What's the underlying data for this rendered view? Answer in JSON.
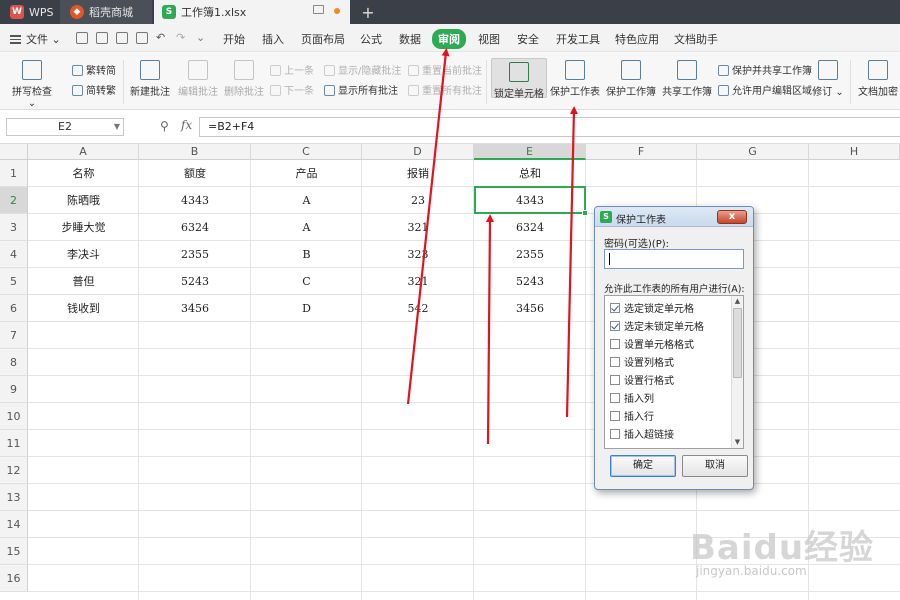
{
  "tabs": {
    "wps": "WPS",
    "shop": "稻壳商城",
    "doc": "工作簿1.xlsx"
  },
  "menu": {
    "file": "文件",
    "items": [
      "开始",
      "插入",
      "页面布局",
      "公式",
      "数据",
      "审阅",
      "视图",
      "安全",
      "开发工具",
      "特色应用",
      "文档助手"
    ],
    "active": "审阅"
  },
  "ribbon": {
    "spellcheck": "拼写检查",
    "to_traditional": "繁转简",
    "to_simplified": "简转繁",
    "new_comment": "新建批注",
    "edit_comment": "编辑批注",
    "delete_comment": "删除批注",
    "prev": "上一条",
    "next": "下一条",
    "show_hide_comment": "显示/隐藏批注",
    "show_all_comments": "显示所有批注",
    "reset_current_comment": "重置当前批注",
    "reset_all_comments": "重置所有批注",
    "lock_cells": "锁定单元格",
    "protect_sheet": "保护工作表",
    "protect_workbook": "保护工作簿",
    "share_workbook": "共享工作簿",
    "protect_share_workbook": "保护并共享工作簿",
    "allow_edit_ranges": "允许用户编辑区域",
    "track_changes": "修订",
    "doc_encrypt": "文档加密"
  },
  "formula_bar": {
    "name_box": "E2",
    "fx": "fx",
    "formula": "=B2+F4"
  },
  "sheet": {
    "columns": [
      "A",
      "B",
      "C",
      "D",
      "E",
      "F",
      "G",
      "H"
    ],
    "rows": [
      "1",
      "2",
      "3",
      "4",
      "5",
      "6",
      "7",
      "8",
      "9",
      "10",
      "11",
      "12",
      "13",
      "14",
      "15",
      "16"
    ],
    "headers": [
      "名称",
      "额度",
      "产品",
      "报销",
      "总和"
    ],
    "data": [
      [
        "陈晒哦",
        "4343",
        "A",
        "23",
        "4343"
      ],
      [
        "步睡大觉",
        "6324",
        "A",
        "321",
        "6324"
      ],
      [
        "李决斗",
        "2355",
        "B",
        "323",
        "2355"
      ],
      [
        "普但",
        "5243",
        "C",
        "321",
        "5243"
      ],
      [
        "钱收到",
        "3456",
        "D",
        "542",
        "3456"
      ]
    ],
    "selected_cell": "E2"
  },
  "dialog": {
    "title": "保护工作表",
    "close": "x",
    "password_label": "密码(可选)(P):",
    "password_value": "",
    "allow_label": "允许此工作表的所有用户进行(A):",
    "options": [
      {
        "label": "选定锁定单元格",
        "checked": true
      },
      {
        "label": "选定未锁定单元格",
        "checked": true
      },
      {
        "label": "设置单元格格式",
        "checked": false
      },
      {
        "label": "设置列格式",
        "checked": false
      },
      {
        "label": "设置行格式",
        "checked": false
      },
      {
        "label": "插入列",
        "checked": false
      },
      {
        "label": "插入行",
        "checked": false
      },
      {
        "label": "插入超链接",
        "checked": false
      }
    ],
    "ok": "确定",
    "cancel": "取消"
  },
  "watermark": {
    "main": "Baidu经验",
    "sub": "jingyan.baidu.com"
  },
  "colors": {
    "accent": "#2eaa54",
    "arrow": "#e0141e",
    "tabbar": "#3b3f47"
  }
}
